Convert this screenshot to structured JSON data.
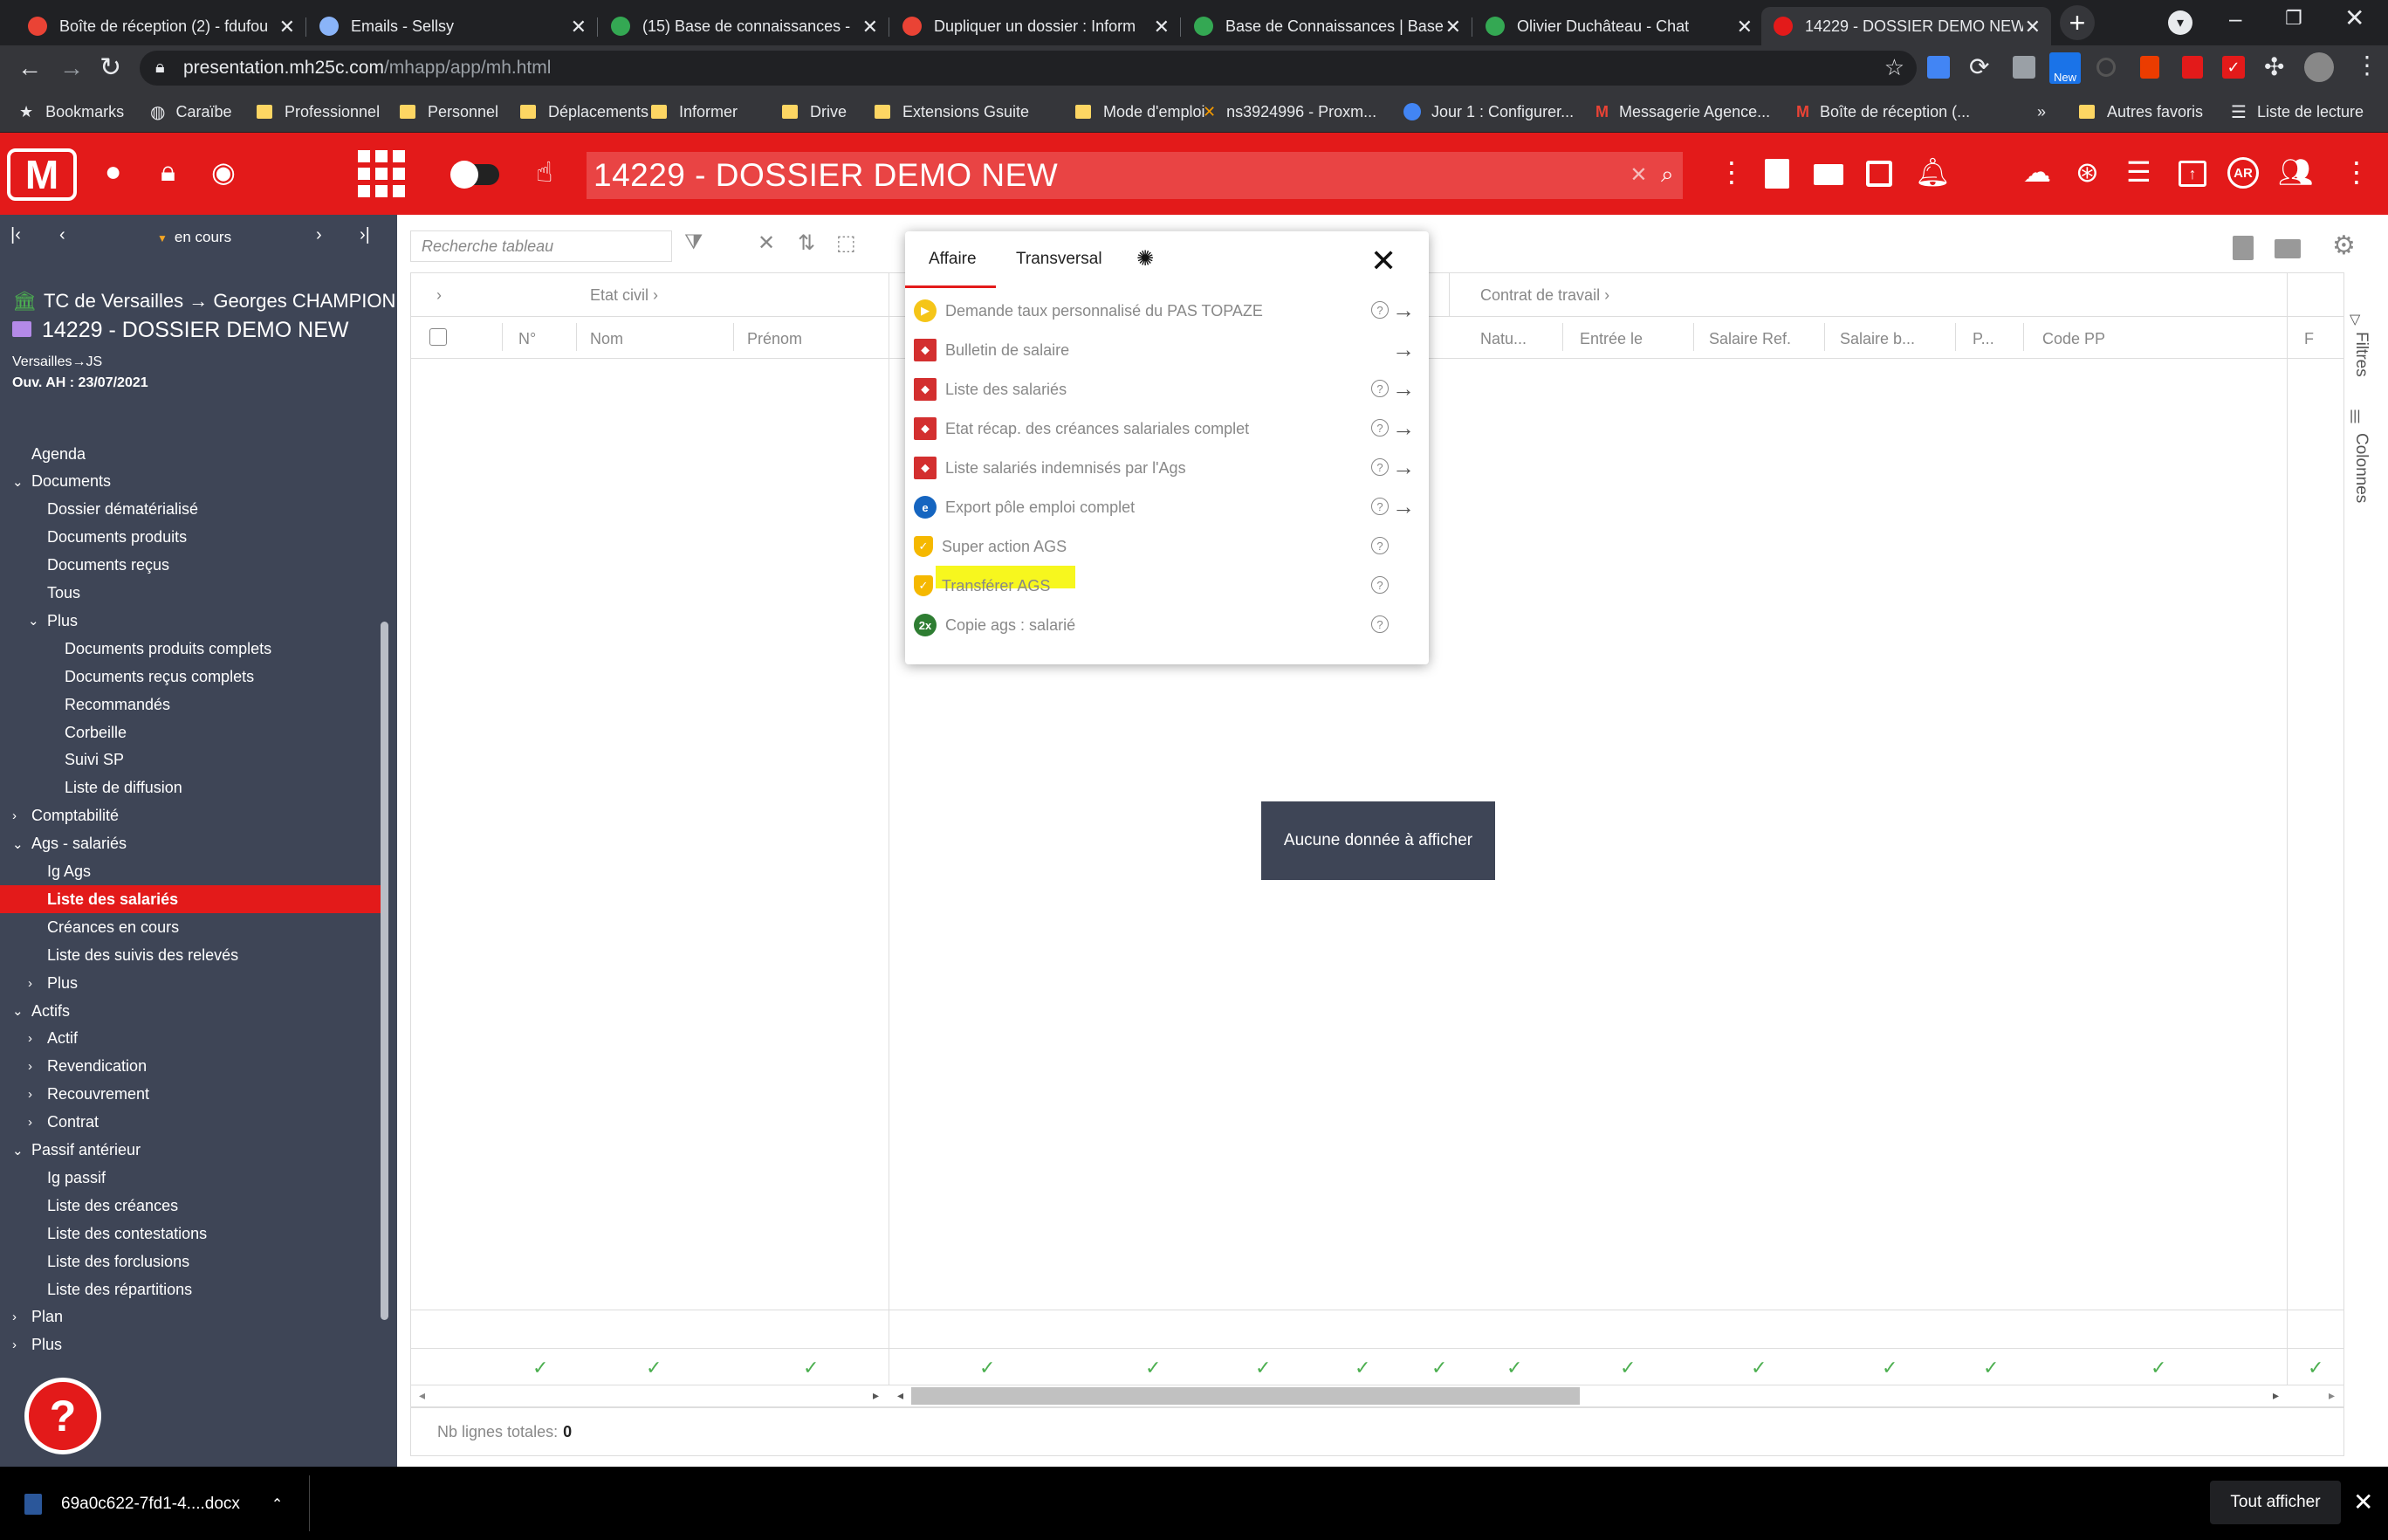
{
  "browser": {
    "tabs": [
      {
        "title": "Boîte de réception (2) - fdufou",
        "favicon_color": "#ea4335"
      },
      {
        "title": "Emails - Sellsy",
        "favicon_color": "#8ab4f8"
      },
      {
        "title": "(15) Base de connaissances - ",
        "favicon_color": "#34a853"
      },
      {
        "title": "Dupliquer un dossier : Inform",
        "favicon_color": "#ea4335"
      },
      {
        "title": "Base de Connaissances | Base",
        "favicon_color": "#34a853"
      },
      {
        "title": "Olivier Duchâteau - Chat",
        "favicon_color": "#34a853"
      },
      {
        "title": "14229 - DOSSIER DEMO NEW",
        "favicon_color": "#e31a1a"
      }
    ],
    "url_host": "presentation.mh25c.com",
    "url_path": "/mhapp/app/mh.html",
    "new_badge": "New",
    "bookmarks": [
      "Bookmarks",
      "Caraïbe",
      "Professionnel",
      "Personnel",
      "Déplacements",
      "Informer",
      "Drive",
      "Extensions Gsuite",
      "Mode d'emploi",
      "ns3924996 - Proxm...",
      "Jour 1 : Configurer...",
      "Messagerie Agence...",
      "Boîte de réception (..."
    ],
    "bookmarks_more": "»",
    "other_bookmarks": "Autres favoris",
    "reading_list": "Liste de lecture"
  },
  "app": {
    "logo": "M",
    "search_value": "14229 - DOSSIER DEMO NEW",
    "accent_color": "#e31a1a",
    "avatar_label": "AR"
  },
  "sidebar": {
    "nav_label": "en cours",
    "court": "TC de Versailles → Georges CHAMPION",
    "dossier": "14229 - DOSSIER DEMO NEW",
    "meta1": "Versailles→JS",
    "meta2": "Ouv. AH : 23/07/2021",
    "items": [
      {
        "label": "Agenda",
        "level": 0,
        "chev": ""
      },
      {
        "label": "Documents",
        "level": 0,
        "chev": "⌄"
      },
      {
        "label": "Dossier dématérialisé",
        "level": 1,
        "chev": ""
      },
      {
        "label": "Documents produits",
        "level": 1,
        "chev": ""
      },
      {
        "label": "Documents reçus",
        "level": 1,
        "chev": ""
      },
      {
        "label": "Tous",
        "level": 1,
        "chev": ""
      },
      {
        "label": "Plus",
        "level": 1,
        "chev": "⌄"
      },
      {
        "label": "Documents produits complets",
        "level": 2,
        "chev": ""
      },
      {
        "label": "Documents reçus complets",
        "level": 2,
        "chev": ""
      },
      {
        "label": "Recommandés",
        "level": 2,
        "chev": ""
      },
      {
        "label": "Corbeille",
        "level": 2,
        "chev": ""
      },
      {
        "label": "Suivi SP",
        "level": 2,
        "chev": ""
      },
      {
        "label": "Liste de diffusion",
        "level": 2,
        "chev": ""
      },
      {
        "label": "Comptabilité",
        "level": 0,
        "chev": "›"
      },
      {
        "label": "Ags - salariés",
        "level": 0,
        "chev": "⌄"
      },
      {
        "label": "Ig Ags",
        "level": 1,
        "chev": ""
      },
      {
        "label": "Liste des salariés",
        "level": 1,
        "chev": "",
        "selected": true
      },
      {
        "label": "Créances en cours",
        "level": 1,
        "chev": ""
      },
      {
        "label": "Liste des suivis des relevés",
        "level": 1,
        "chev": ""
      },
      {
        "label": "Plus",
        "level": 1,
        "chev": "›"
      },
      {
        "label": "Actifs",
        "level": 0,
        "chev": "⌄"
      },
      {
        "label": "Actif",
        "level": 1,
        "chev": "›"
      },
      {
        "label": "Revendication",
        "level": 1,
        "chev": "›"
      },
      {
        "label": "Recouvrement",
        "level": 1,
        "chev": "›"
      },
      {
        "label": "Contrat",
        "level": 1,
        "chev": "›"
      },
      {
        "label": "Passif antérieur",
        "level": 0,
        "chev": "⌄"
      },
      {
        "label": "Ig passif",
        "level": 1,
        "chev": ""
      },
      {
        "label": "Liste des créances",
        "level": 1,
        "chev": ""
      },
      {
        "label": "Liste des contestations",
        "level": 1,
        "chev": ""
      },
      {
        "label": "Liste des forclusions",
        "level": 1,
        "chev": ""
      },
      {
        "label": "Liste des répartitions",
        "level": 1,
        "chev": ""
      },
      {
        "label": "Plan",
        "level": 0,
        "chev": "›"
      },
      {
        "label": "Plus",
        "level": 0,
        "chev": "›"
      }
    ]
  },
  "toolbar": {
    "search_placeholder": "Recherche tableau"
  },
  "grid": {
    "group_headers": [
      "Etat civil",
      "Contrat de travail"
    ],
    "columns": [
      "N°",
      "Nom",
      "Prénom",
      "Natu...",
      "Entrée le",
      "Salaire Ref.",
      "Salaire b...",
      "P...",
      "Code PP",
      "F"
    ],
    "empty_message": "Aucune donnée à afficher",
    "total_label": "Nb lignes totales:",
    "total_value": "0"
  },
  "right_panel": {
    "filters": "Filtres",
    "columns": "Colonnes"
  },
  "popup": {
    "tabs": [
      "Affaire",
      "Transversal"
    ],
    "items": [
      {
        "label": "Demande taux personnalisé du PAS TOPAZE",
        "icon": "play-circle-icon",
        "help": true,
        "arrow": true
      },
      {
        "label": "Bulletin de salaire",
        "icon": "pdf-icon",
        "help": false,
        "arrow": true
      },
      {
        "label": "Liste des salariés",
        "icon": "pdf-icon",
        "help": true,
        "arrow": true
      },
      {
        "label": "Etat récap. des créances salariales complet",
        "icon": "pdf-icon",
        "help": true,
        "arrow": true
      },
      {
        "label": "Liste salariés indemnisés par l'Ags",
        "icon": "pdf-icon",
        "help": true,
        "arrow": true
      },
      {
        "label": "Export pôle emploi complet",
        "icon": "globe-icon",
        "help": true,
        "arrow": true
      },
      {
        "label": "Super action AGS",
        "icon": "shield-icon",
        "help": true,
        "arrow": false
      },
      {
        "label": "Transférer AGS",
        "icon": "shield-icon",
        "help": true,
        "arrow": false
      },
      {
        "label": "Copie ags : salarié",
        "icon": "ezx-icon",
        "help": true,
        "arrow": false
      }
    ]
  },
  "downloads": {
    "file": "69a0c622-7fd1-4....docx",
    "show_all": "Tout afficher"
  }
}
